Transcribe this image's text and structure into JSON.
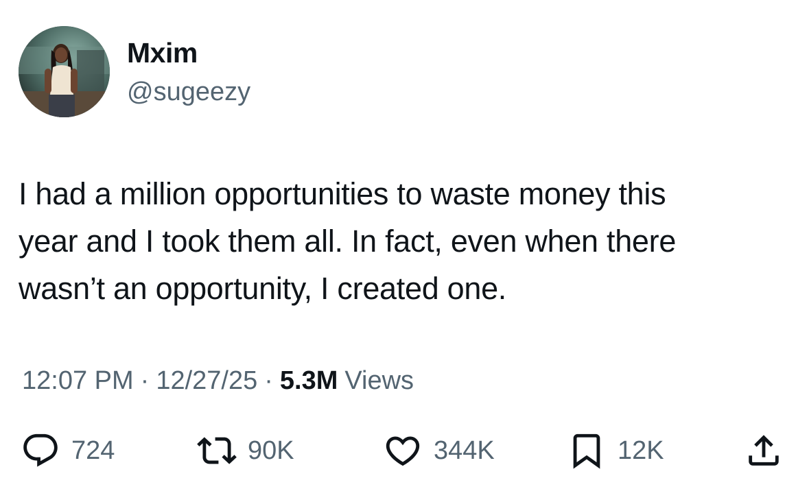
{
  "user": {
    "display_name": "Mxim",
    "handle": "@sugeezy"
  },
  "tweet": {
    "text_lines": [
      "I had a million opportunities to waste money this",
      "year and I took them all. In fact, even when there",
      "wasn’t an opportunity, I created one."
    ]
  },
  "meta": {
    "time": "12:07 PM",
    "separator": "·",
    "date": "12/27/25",
    "views_count": "5.3M",
    "views_label": "Views"
  },
  "actions": {
    "replies": "724",
    "reposts": "90K",
    "likes": "344K",
    "bookmarks": "12K"
  },
  "icons": {
    "reply": "speech-bubble-icon",
    "repost": "repost-arrows-icon",
    "like": "heart-icon",
    "bookmark": "bookmark-icon",
    "share": "share-upload-icon"
  },
  "colors": {
    "text_primary": "#0f1419",
    "text_secondary": "#536471",
    "background": "#ffffff"
  }
}
